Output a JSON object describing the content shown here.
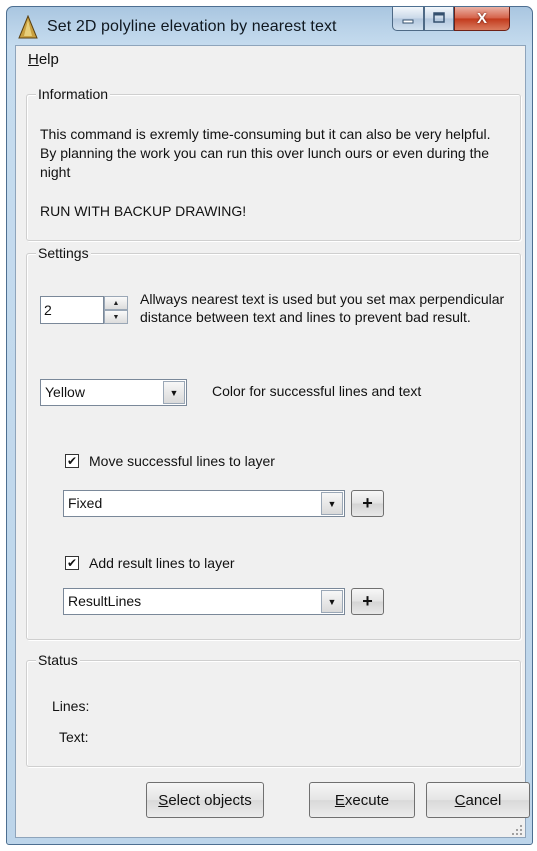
{
  "window": {
    "title": "Set 2D polyline elevation by nearest text",
    "close_glyph": "X"
  },
  "menu": {
    "help_mnemonic": "H",
    "help_rest": "elp"
  },
  "information": {
    "legend": "Information",
    "text": "This command is exremly time-consuming but it can also be very helpful. By planning the work you can run this over lunch ours or even during the night",
    "warning": "RUN WITH BACKUP DRAWING!"
  },
  "settings": {
    "legend": "Settings",
    "distance_value": "2",
    "distance_description": "Allways nearest text is used but you set max perpendicular distance between text and lines to prevent bad result.",
    "color_value": "Yellow",
    "color_description": "Color for successful lines and text",
    "move_checkbox": {
      "label": "Move successful lines to layer",
      "checked": true,
      "mark": "✔"
    },
    "move_layer_value": "Fixed",
    "add_checkbox": {
      "label": "Add result lines to layer",
      "checked": true,
      "mark": "✔"
    },
    "add_layer_value": "ResultLines",
    "plus_glyph": "+"
  },
  "status": {
    "legend": "Status",
    "lines_label": "Lines:",
    "text_label": "Text:"
  },
  "buttons": {
    "select_mnemonic": "S",
    "select_rest": "elect objects",
    "execute_mnemonic": "E",
    "execute_rest": "xecute",
    "cancel_mnemonic": "C",
    "cancel_rest": "ancel"
  },
  "colors": {
    "title_gradient": "#b9d2e8",
    "client_background": "#f0f0f0",
    "close_button": "#c2391c"
  },
  "icons": {
    "app": "warning-triangle-icon",
    "minimize": "minimize-icon",
    "maximize": "maximize-icon",
    "close": "close-icon",
    "spin_up": "spin-up-arrow-icon",
    "spin_down": "spin-down-arrow-icon",
    "dropdown": "chevron-down-icon",
    "add": "plus-icon",
    "grip": "resize-grip-icon"
  }
}
